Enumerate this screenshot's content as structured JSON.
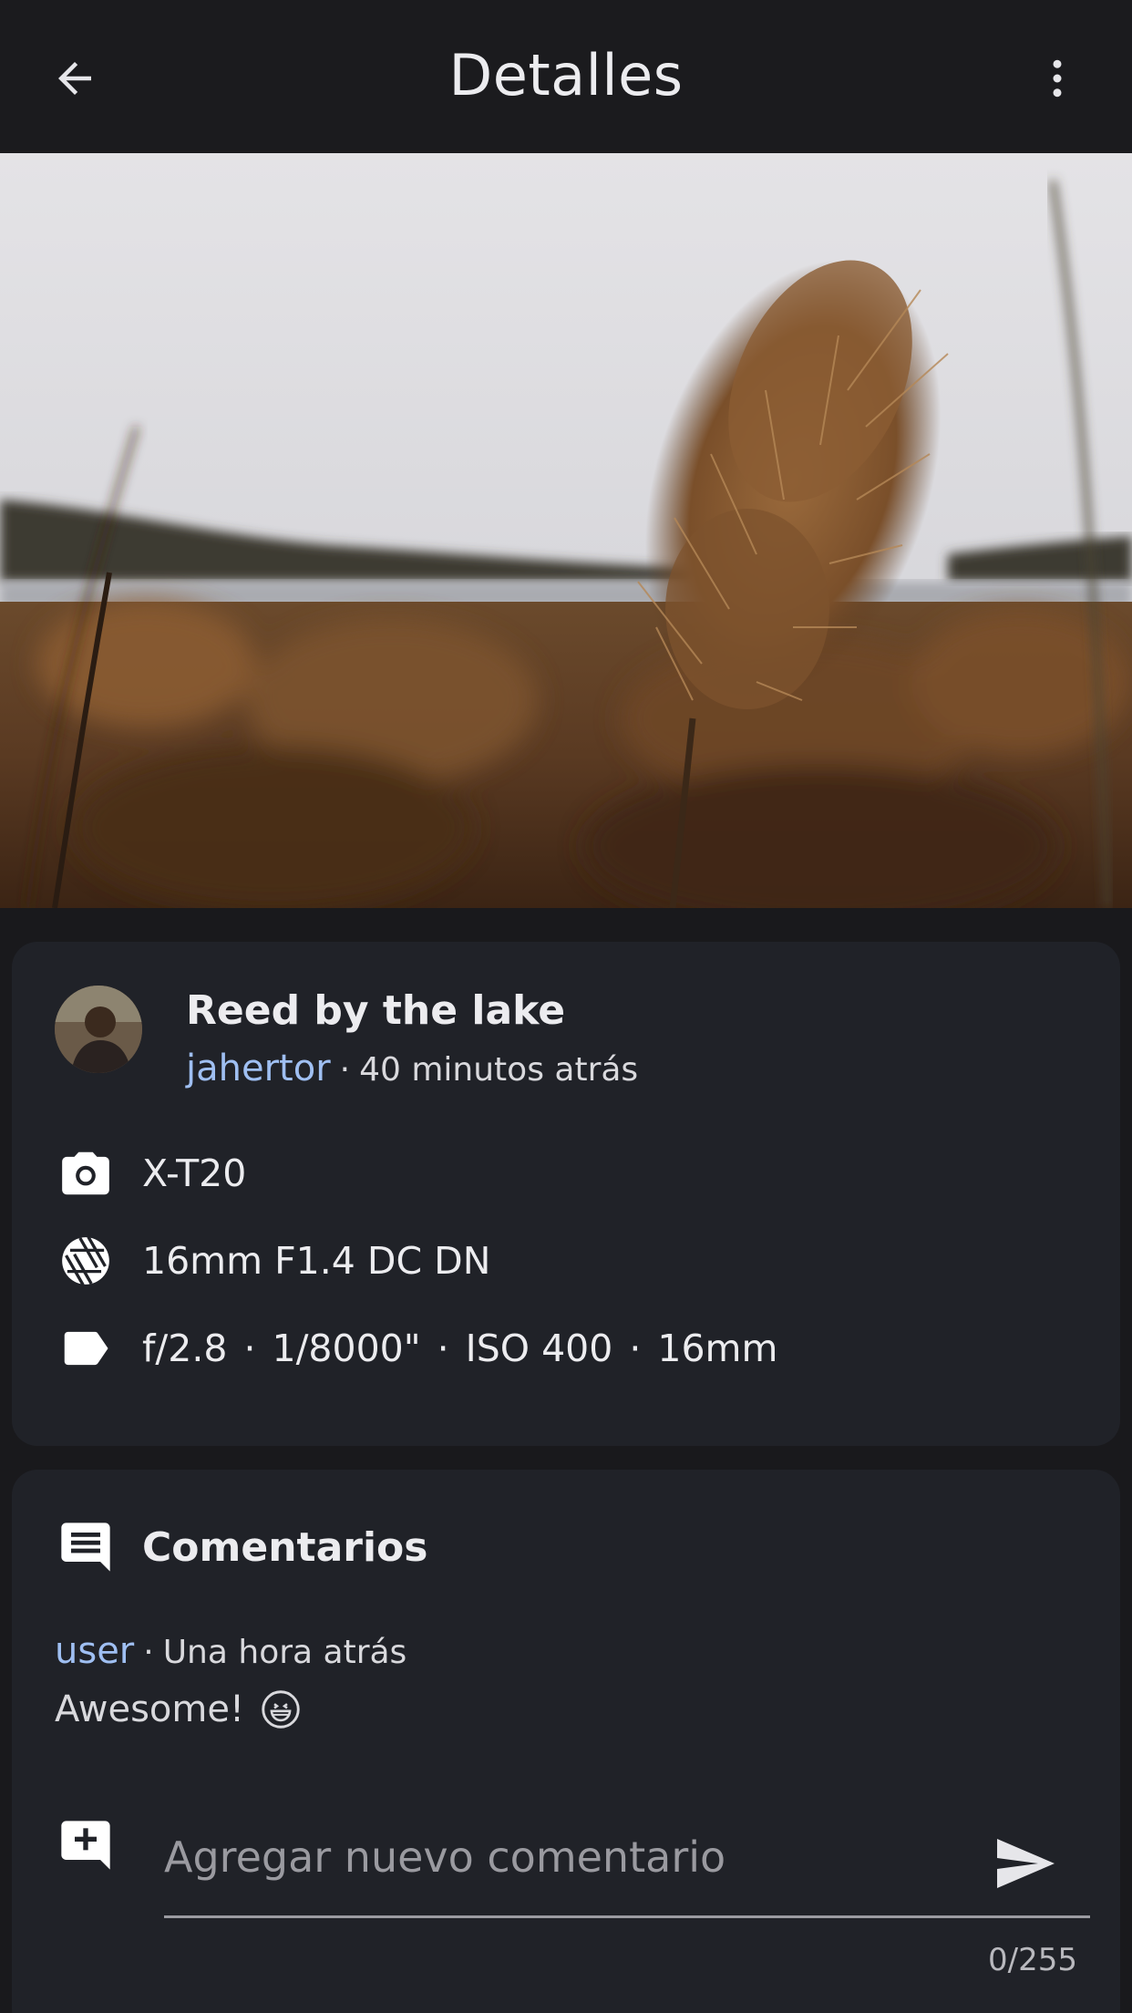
{
  "appbar": {
    "title": "Detalles",
    "back_icon": "arrow-left-icon",
    "menu_icon": "more-vertical-icon"
  },
  "photo": {
    "title": "Reed by the lake",
    "author": "jahertor",
    "time": "40 minutos atrás",
    "separator": "·"
  },
  "exif": {
    "camera": "X-T20",
    "lens": "16mm F1.4 DC DN",
    "aperture": "f/2.8",
    "shutter": "1/8000\"",
    "iso": "ISO 400",
    "focal": "16mm",
    "separator": "·"
  },
  "comments": {
    "heading": "Comentarios",
    "items": [
      {
        "user": "user",
        "time": "Una hora atrás",
        "text": "Awesome!"
      }
    ],
    "input_placeholder": "Agregar nuevo comentario",
    "counter": "0/255"
  },
  "colors": {
    "background": "#19191c",
    "card": "#202228",
    "accent_link": "#9fbff2"
  }
}
